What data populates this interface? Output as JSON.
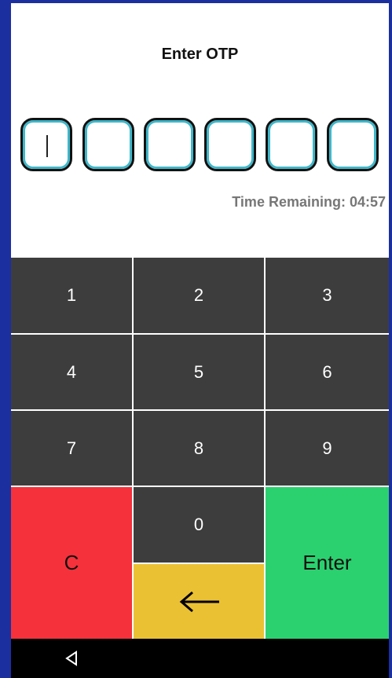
{
  "header": {
    "title": "Enter OTP"
  },
  "otp": {
    "digits": [
      "",
      "",
      "",
      "",
      "",
      ""
    ]
  },
  "timer": {
    "text": "Time Remaining: 04:57"
  },
  "keypad": {
    "key_1": "1",
    "key_2": "2",
    "key_3": "3",
    "key_4": "4",
    "key_5": "5",
    "key_6": "6",
    "key_7": "7",
    "key_8": "8",
    "key_9": "9",
    "key_0": "0",
    "clear": "C",
    "enter": "Enter",
    "backspace": "←"
  },
  "colors": {
    "frame": "#1c2f9e",
    "key_dark": "#3d3d3d",
    "clear": "#f5313b",
    "enter": "#2bd16f",
    "backspace": "#ebc134",
    "otp_border_inner": "#3fb7c9"
  },
  "icons": {
    "nav_back": "triangle-back-icon"
  }
}
